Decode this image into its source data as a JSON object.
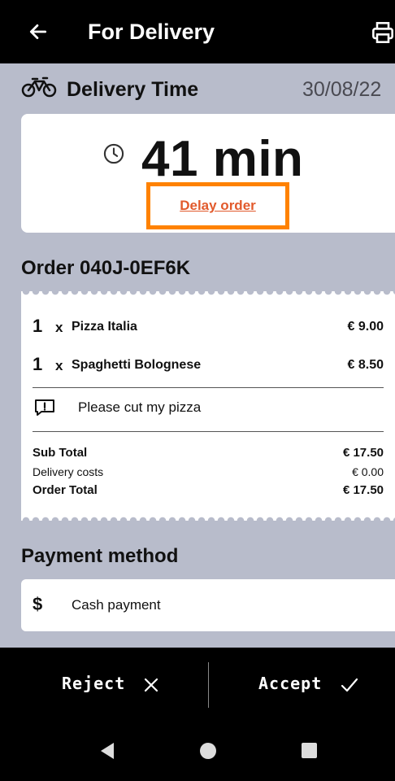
{
  "header": {
    "title": "For Delivery",
    "back_icon": "arrow-left-icon",
    "print_icon": "printer-icon"
  },
  "delivery": {
    "label": "Delivery Time",
    "date": "30/08/22",
    "time": "41 min",
    "delay_label": "Delay order"
  },
  "order": {
    "title": "Order 040J-0EF6K",
    "items": [
      {
        "qty": "1",
        "x": "x",
        "name": "Pizza Italia",
        "price": "€ 9.00"
      },
      {
        "qty": "1",
        "x": "x",
        "name": "Spaghetti Bolognese",
        "price": "€ 8.50"
      }
    ],
    "note": "Please cut my pizza",
    "subtotal_label": "Sub Total",
    "subtotal": "€ 17.50",
    "delivery_label": "Delivery costs",
    "delivery_costs": "€ 0.00",
    "total_label": "Order Total",
    "total": "€ 17.50"
  },
  "payment": {
    "title": "Payment method",
    "icon": "$",
    "method": "Cash payment"
  },
  "actions": {
    "reject": "Reject",
    "accept": "Accept"
  },
  "colors": {
    "accent": "#e25a2c",
    "highlight": "#ff8200",
    "background": "#b8bccb"
  }
}
